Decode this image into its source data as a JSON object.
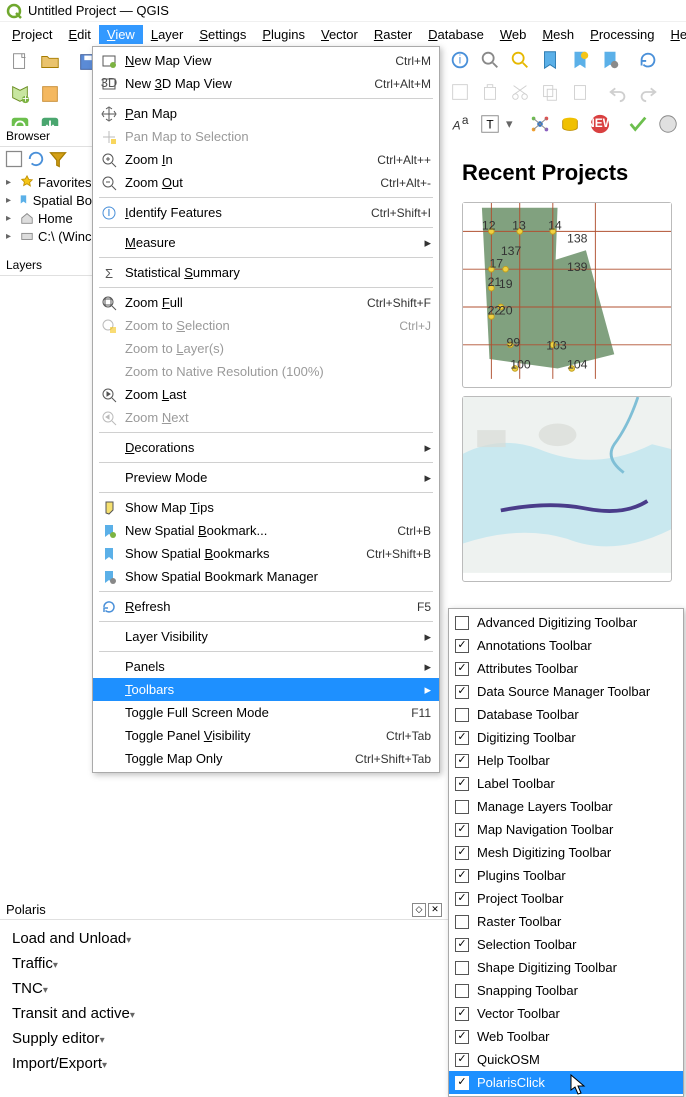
{
  "title": "Untitled Project — QGIS",
  "menubar": [
    "Project",
    "Edit",
    "View",
    "Layer",
    "Settings",
    "Plugins",
    "Vector",
    "Raster",
    "Database",
    "Web",
    "Mesh",
    "Processing",
    "Help"
  ],
  "active_menu_index": 2,
  "browser": {
    "title": "Browser",
    "items": [
      {
        "label": "Favorites",
        "icon": "star"
      },
      {
        "label": "Spatial Bo",
        "icon": "bookmark"
      },
      {
        "label": "Home",
        "icon": "home"
      },
      {
        "label": "C:\\ (Winc",
        "icon": "drive"
      }
    ]
  },
  "layers": {
    "title": "Layers"
  },
  "recent_title": "Recent Projects",
  "polaris": {
    "title": "Polaris",
    "items": [
      "Load and Unload",
      "Traffic",
      "TNC",
      "Transit and active",
      "Supply editor",
      "Import/Export"
    ]
  },
  "view_menu": [
    {
      "label": "New Map View",
      "shortcut": "Ctrl+M",
      "icon": "newmap",
      "u": 0
    },
    {
      "label": "New 3D Map View",
      "shortcut": "Ctrl+Alt+M",
      "icon": "3d",
      "u": 4
    },
    {
      "sep": true
    },
    {
      "label": "Pan Map",
      "icon": "pan",
      "u": 0
    },
    {
      "label": "Pan Map to Selection",
      "icon": "pansel",
      "disabled": true
    },
    {
      "label": "Zoom In",
      "shortcut": "Ctrl+Alt++",
      "icon": "zoomin",
      "u": 5
    },
    {
      "label": "Zoom Out",
      "shortcut": "Ctrl+Alt+-",
      "icon": "zoomout",
      "u": 5
    },
    {
      "sep": true
    },
    {
      "label": "Identify Features",
      "shortcut": "Ctrl+Shift+I",
      "icon": "identify",
      "u": 0
    },
    {
      "sep": true
    },
    {
      "label": "Measure",
      "submenu": true,
      "u": 0
    },
    {
      "sep": true
    },
    {
      "label": "Statistical Summary",
      "icon": "sigma",
      "u": 12
    },
    {
      "sep": true
    },
    {
      "label": "Zoom Full",
      "shortcut": "Ctrl+Shift+F",
      "icon": "zoomfull",
      "u": 5
    },
    {
      "label": "Zoom to Selection",
      "shortcut": "Ctrl+J",
      "icon": "zoomsel",
      "disabled": true,
      "u": 8
    },
    {
      "label": "Zoom to Layer(s)",
      "disabled": true,
      "u": 8
    },
    {
      "label": "Zoom to Native Resolution (100%)",
      "disabled": true
    },
    {
      "label": "Zoom Last",
      "icon": "zoomlast",
      "u": 5
    },
    {
      "label": "Zoom Next",
      "icon": "zoomnext",
      "disabled": true,
      "u": 5
    },
    {
      "sep": true
    },
    {
      "label": "Decorations",
      "submenu": true,
      "u": 0
    },
    {
      "sep": true
    },
    {
      "label": "Preview Mode",
      "submenu": true
    },
    {
      "sep": true
    },
    {
      "label": "Show Map Tips",
      "icon": "tips",
      "u": 9
    },
    {
      "label": "New Spatial Bookmark...",
      "shortcut": "Ctrl+B",
      "icon": "newbookmark",
      "u": 12
    },
    {
      "label": "Show Spatial Bookmarks",
      "shortcut": "Ctrl+Shift+B",
      "icon": "bookmarks",
      "u": 13
    },
    {
      "label": "Show Spatial Bookmark Manager",
      "icon": "bookmarkmgr"
    },
    {
      "sep": true
    },
    {
      "label": "Refresh",
      "shortcut": "F5",
      "icon": "refresh",
      "u": 0
    },
    {
      "sep": true
    },
    {
      "label": "Layer Visibility",
      "submenu": true
    },
    {
      "sep": true
    },
    {
      "label": "Panels",
      "submenu": true
    },
    {
      "label": "Toolbars",
      "submenu": true,
      "u": 0,
      "highlight": true
    },
    {
      "label": "Toggle Full Screen Mode",
      "shortcut": "F11"
    },
    {
      "label": "Toggle Panel Visibility",
      "shortcut": "Ctrl+Tab",
      "u": 13
    },
    {
      "label": "Toggle Map Only",
      "shortcut": "Ctrl+Shift+Tab"
    }
  ],
  "toolbars_submenu": [
    {
      "label": "Advanced Digitizing Toolbar",
      "checked": false
    },
    {
      "label": "Annotations Toolbar",
      "checked": true
    },
    {
      "label": "Attributes Toolbar",
      "checked": true
    },
    {
      "label": "Data Source Manager Toolbar",
      "checked": true
    },
    {
      "label": "Database Toolbar",
      "checked": false
    },
    {
      "label": "Digitizing Toolbar",
      "checked": true
    },
    {
      "label": "Help Toolbar",
      "checked": true
    },
    {
      "label": "Label Toolbar",
      "checked": true
    },
    {
      "label": "Manage Layers Toolbar",
      "checked": false
    },
    {
      "label": "Map Navigation Toolbar",
      "checked": true
    },
    {
      "label": "Mesh Digitizing Toolbar",
      "checked": true
    },
    {
      "label": "Plugins Toolbar",
      "checked": true
    },
    {
      "label": "Project Toolbar",
      "checked": true
    },
    {
      "label": "Raster Toolbar",
      "checked": false
    },
    {
      "label": "Selection Toolbar",
      "checked": true
    },
    {
      "label": "Shape Digitizing Toolbar",
      "checked": false
    },
    {
      "label": "Snapping Toolbar",
      "checked": false
    },
    {
      "label": "Vector Toolbar",
      "checked": true
    },
    {
      "label": "Web Toolbar",
      "checked": true
    },
    {
      "label": "QuickOSM",
      "checked": true
    },
    {
      "label": "PolarisClick",
      "checked": true,
      "highlight": true
    }
  ]
}
